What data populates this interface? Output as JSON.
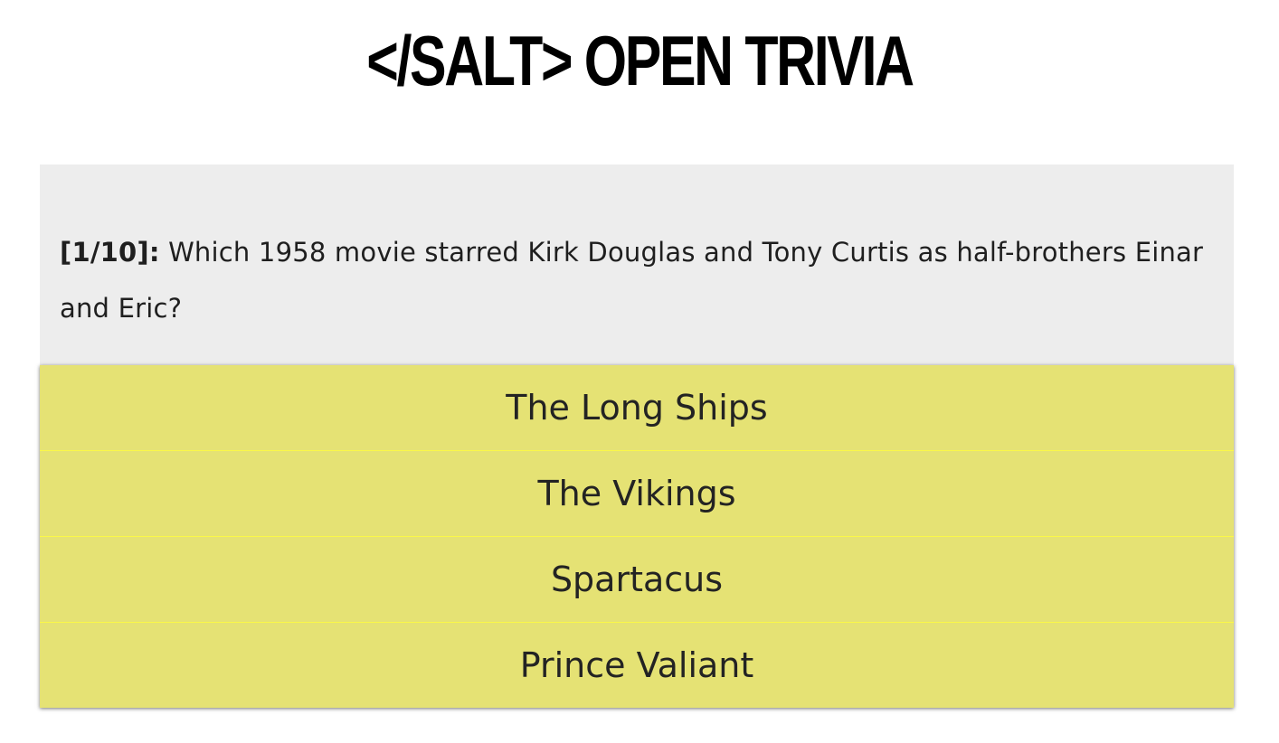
{
  "header": {
    "title": "</SALT> OPEN TRIVIA"
  },
  "question": {
    "counter": "[1/10]:",
    "text": "Which 1958 movie starred Kirk Douglas and Tony Curtis as half-brothers Einar and Eric?"
  },
  "answers": [
    {
      "label": "The Long Ships"
    },
    {
      "label": "The Vikings"
    },
    {
      "label": "Spartacus"
    },
    {
      "label": "Prince Valiant"
    }
  ],
  "colors": {
    "answer_background": "#e5e274",
    "answer_divider": "#fbf848",
    "question_background": "#ededed"
  }
}
